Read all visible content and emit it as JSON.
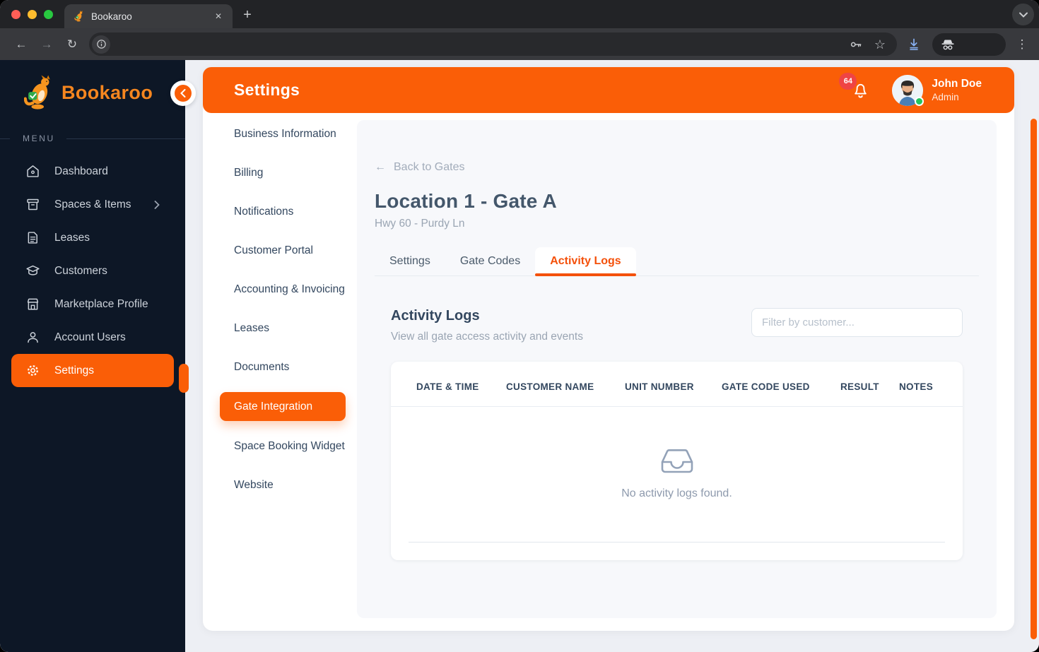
{
  "browser": {
    "tab_title": "Bookaroo",
    "new_tab_glyph": "+",
    "close_glyph": "✕",
    "back_glyph": "←",
    "forward_glyph": "→",
    "reload_glyph": "↻",
    "menu_glyph": "⋮",
    "star_glyph": "☆"
  },
  "sidebar": {
    "brand": "Bookaroo",
    "menu_label": "MENU",
    "items": [
      {
        "label": "Dashboard",
        "icon": "home-icon",
        "active": false
      },
      {
        "label": "Spaces & Items",
        "icon": "box-icon",
        "active": false,
        "has_submenu": true
      },
      {
        "label": "Leases",
        "icon": "document-icon",
        "active": false
      },
      {
        "label": "Customers",
        "icon": "customers-icon",
        "active": false
      },
      {
        "label": "Marketplace Profile",
        "icon": "storefront-icon",
        "active": false
      },
      {
        "label": "Account Users",
        "icon": "user-icon",
        "active": false
      },
      {
        "label": "Settings",
        "icon": "gear-icon",
        "active": true
      }
    ]
  },
  "header": {
    "title": "Settings",
    "notification_count": "64",
    "user_name": "John Doe",
    "user_role": "Admin"
  },
  "settings_nav": {
    "items": [
      {
        "label": "Business Information",
        "active": false
      },
      {
        "label": "Billing",
        "active": false
      },
      {
        "label": "Notifications",
        "active": false
      },
      {
        "label": "Customer Portal",
        "active": false
      },
      {
        "label": "Accounting & Invoicing",
        "active": false
      },
      {
        "label": "Leases",
        "active": false
      },
      {
        "label": "Documents",
        "active": false
      },
      {
        "label": "Gate Integration",
        "active": true
      },
      {
        "label": "Space Booking Widget",
        "active": false
      },
      {
        "label": "Website",
        "active": false
      }
    ]
  },
  "content": {
    "back_link": "Back to Gates",
    "back_arrow": "←",
    "title": "Location 1 - Gate A",
    "subtitle": "Hwy 60 - Purdy Ln",
    "tabs": [
      {
        "label": "Settings",
        "active": false
      },
      {
        "label": "Gate Codes",
        "active": false
      },
      {
        "label": "Activity Logs",
        "active": true
      }
    ],
    "section_title": "Activity Logs",
    "section_subtitle": "View all gate access activity and events",
    "filter_placeholder": "Filter by customer...",
    "table": {
      "columns": [
        "DATE & TIME",
        "CUSTOMER NAME",
        "UNIT NUMBER",
        "GATE CODE USED",
        "RESULT",
        "NOTES"
      ],
      "rows": [],
      "empty_text": "No activity logs found."
    }
  },
  "colors": {
    "accent_orange": "#FA5E07",
    "sidebar_navy": "#0D1726",
    "brand_orange": "#F5861F",
    "badge_red": "#EF4444",
    "online_green": "#22C55E",
    "content_bg": "#F7F8FB"
  }
}
